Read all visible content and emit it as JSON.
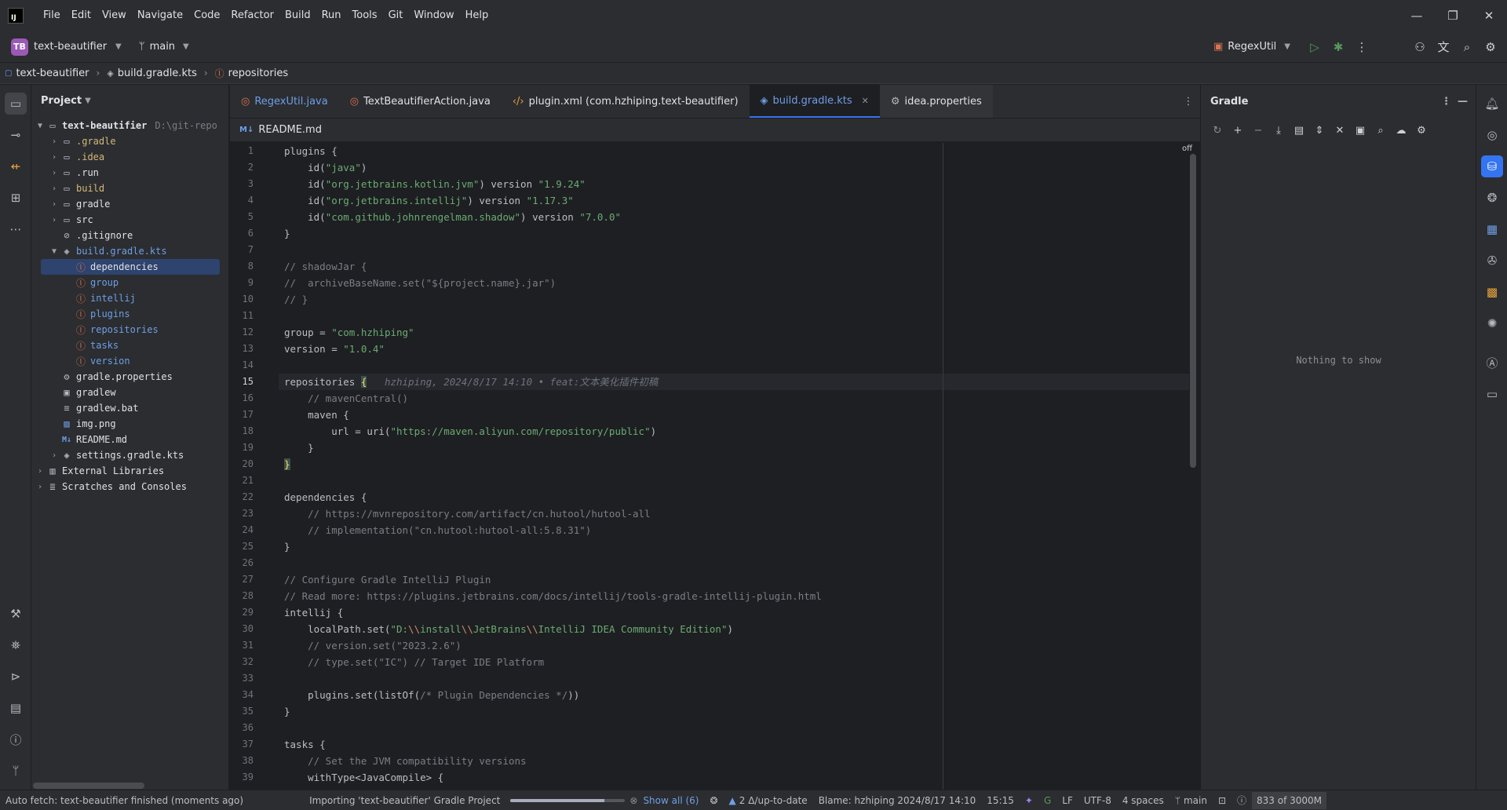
{
  "menu": [
    "File",
    "Edit",
    "View",
    "Navigate",
    "Code",
    "Refactor",
    "Build",
    "Run",
    "Tools",
    "Git",
    "Window",
    "Help"
  ],
  "app_logo": "IJ",
  "toolbar": {
    "project_badge": "TB",
    "project_name": "text-beautifier",
    "branch": "main",
    "run_config": "RegexUtil"
  },
  "breadcrumb": [
    "text-beautifier",
    "build.gradle.kts",
    "repositories"
  ],
  "project_panel": {
    "title": "Project",
    "root_path": "D:\\git-repo",
    "items": [
      {
        "label": "text-beautifier"
      },
      {
        "label": ".gradle"
      },
      {
        "label": ".idea"
      },
      {
        "label": ".run"
      },
      {
        "label": "build"
      },
      {
        "label": "gradle"
      },
      {
        "label": "src"
      },
      {
        "label": ".gitignore"
      },
      {
        "label": "build.gradle.kts"
      },
      {
        "label": "dependencies"
      },
      {
        "label": "group"
      },
      {
        "label": "intellij"
      },
      {
        "label": "plugins"
      },
      {
        "label": "repositories"
      },
      {
        "label": "tasks"
      },
      {
        "label": "version"
      },
      {
        "label": "gradle.properties"
      },
      {
        "label": "gradlew"
      },
      {
        "label": "gradlew.bat"
      },
      {
        "label": "img.png"
      },
      {
        "label": "README.md"
      },
      {
        "label": "settings.gradle.kts"
      },
      {
        "label": "External Libraries"
      },
      {
        "label": "Scratches and Consoles"
      }
    ]
  },
  "tabs": [
    {
      "label": "RegexUtil.java"
    },
    {
      "label": "TextBeautifierAction.java"
    },
    {
      "label": "plugin.xml (com.hzhiping.text-beautifier)"
    },
    {
      "label": "build.gradle.kts"
    },
    {
      "label": "idea.properties"
    }
  ],
  "editor": {
    "subheader_file": "README.md",
    "off_label": "off",
    "current_line": 15,
    "blame_hint": "hzhiping, 2024/8/17 14:10 • feat:文本美化插件初稿",
    "lines": [
      "plugins {",
      "    id(\"java\")",
      "    id(\"org.jetbrains.kotlin.jvm\") version \"1.9.24\"",
      "    id(\"org.jetbrains.intellij\") version \"1.17.3\"",
      "    id(\"com.github.johnrengelman.shadow\") version \"7.0.0\"",
      "}",
      "",
      "// shadowJar {",
      "//  archiveBaseName.set(\"${project.name}.jar\")",
      "// }",
      "",
      "group = \"com.hzhiping\"",
      "version = \"1.0.4\"",
      "",
      "repositories {",
      "    // mavenCentral()",
      "    maven {",
      "        url = uri(\"https://maven.aliyun.com/repository/public\")",
      "    }",
      "}",
      "",
      "dependencies {",
      "    // https://mvnrepository.com/artifact/cn.hutool/hutool-all",
      "    // implementation(\"cn.hutool:hutool-all:5.8.31\")",
      "}",
      "",
      "// Configure Gradle IntelliJ Plugin",
      "// Read more: https://plugins.jetbrains.com/docs/intellij/tools-gradle-intellij-plugin.html",
      "intellij {",
      "    localPath.set(\"D:\\\\install\\\\JetBrains\\\\IntelliJ IDEA Community Edition\")",
      "    // version.set(\"2023.2.6\")",
      "    // type.set(\"IC\") // Target IDE Platform",
      "",
      "    plugins.set(listOf(/* Plugin Dependencies */))",
      "}",
      "",
      "tasks {",
      "    // Set the JVM compatibility versions",
      "    withType<JavaCompile> {"
    ]
  },
  "gradle_panel": {
    "title": "Gradle",
    "empty_text": "Nothing to show"
  },
  "statusbar": {
    "left": "Auto fetch: text-beautifier finished (moments ago)",
    "task": "Importing 'text-beautifier' Gradle Project",
    "progress": 0.82,
    "show_all": "Show all (6)",
    "updates": "2 Δ/up-to-date",
    "blame": "Blame: hzhiping 2024/8/17 14:10",
    "position": "15:15",
    "line_sep": "LF",
    "encoding": "UTF-8",
    "indent": "4 spaces",
    "branch": "main",
    "memory": "833 of 3000M"
  },
  "colors": {
    "accent": "#3574f0",
    "background": "#1e1f22",
    "panel": "#2b2d30",
    "string": "#6aab73",
    "comment": "#7a7e85"
  }
}
